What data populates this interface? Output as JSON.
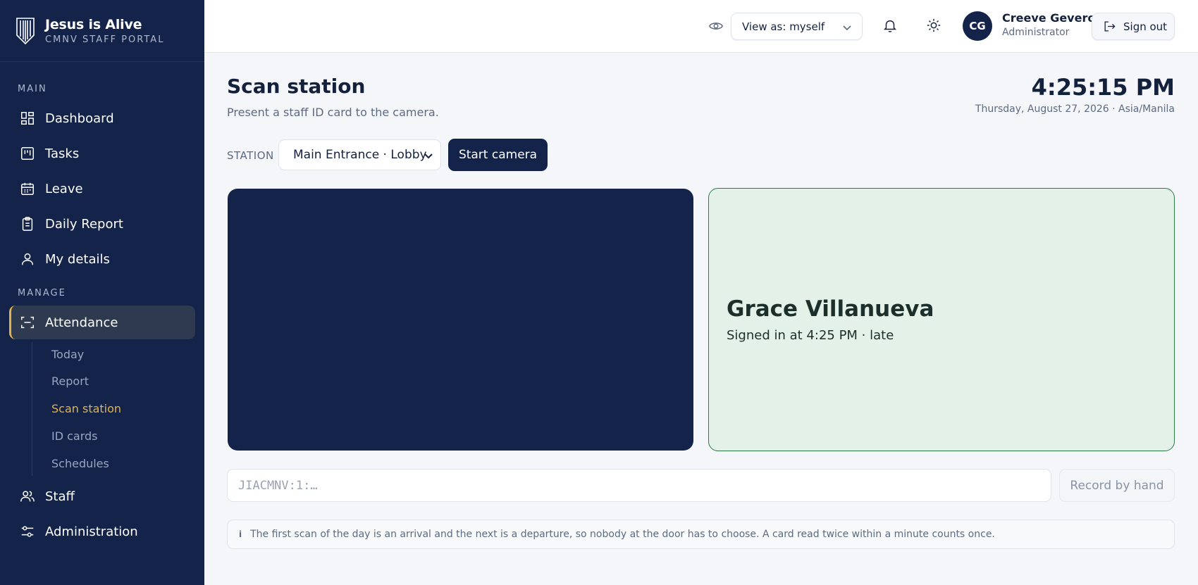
{
  "brand": {
    "title": "Jesus is Alive",
    "subtitle": "CMNV STAFF PORTAL"
  },
  "sidebar": {
    "section_main": "MAIN",
    "section_manage": "MANAGE",
    "items": [
      {
        "label": "Dashboard",
        "icon": "dashboard-icon"
      },
      {
        "label": "Tasks",
        "icon": "tasks-icon"
      },
      {
        "label": "Leave",
        "icon": "calendar-icon"
      },
      {
        "label": "Daily Report",
        "icon": "clipboard-icon"
      },
      {
        "label": "My details",
        "icon": "user-icon"
      },
      {
        "label": "Attendance",
        "icon": "scan-icon",
        "active": true
      },
      {
        "label": "Staff",
        "icon": "users-icon"
      },
      {
        "label": "Administration",
        "icon": "sliders-icon"
      }
    ],
    "attendance_sub": [
      "Today",
      "Report",
      "Scan station",
      "ID cards",
      "Schedules"
    ],
    "active_sub": "Scan station",
    "accent_color": "#e3b34a"
  },
  "topbar": {
    "view_as": "View as: myself",
    "user": {
      "initials": "CG",
      "name": "Creeve Gevero",
      "role": "Administrator"
    },
    "signout_label": "Sign out"
  },
  "main": {
    "title": "Scan station",
    "subtitle": "Present a staff ID card to the camera.",
    "clock": "4:25:15 PM",
    "date": "Thursday, August 27, 2026 · Asia/Manila",
    "station_label": "STATION",
    "station_value": "Main Entrance · Lobby",
    "start_camera_label": "Start camera",
    "result": {
      "name": "Grace Villanueva",
      "status": "Signed in at 4:25 PM · late",
      "color": "#2e7a45"
    },
    "code_placeholder": "JIACMNV:1:…",
    "record_label": "Record by hand",
    "info_text": "The first scan of the day is an arrival and the next is a departure, so nobody at the door has to choose. A card read twice within a minute counts once."
  }
}
